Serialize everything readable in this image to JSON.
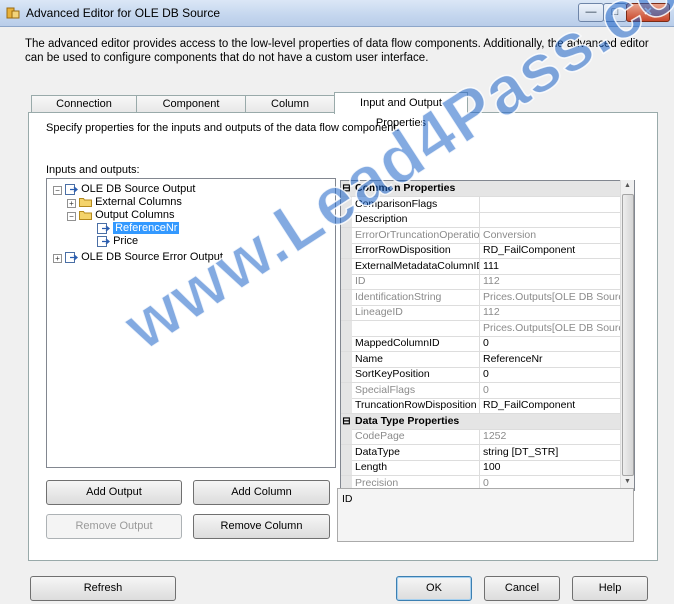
{
  "window": {
    "title": "Advanced Editor for OLE DB Source"
  },
  "description": "The advanced editor provides access to the low-level properties of data flow components. Additionally, the advanced editor can be used to configure components that do not have a custom user interface.",
  "tabs": [
    {
      "label": "Connection Managers"
    },
    {
      "label": "Component Properties"
    },
    {
      "label": "Column Mappings"
    },
    {
      "label": "Input and Output Properties"
    }
  ],
  "panel": {
    "description": "Specify properties for the inputs and outputs of the data flow component.",
    "tree_label": "Inputs and outputs:"
  },
  "tree": {
    "output": "OLE DB Source Output",
    "external": "External Columns",
    "output_columns": "Output Columns",
    "col1": "ReferenceNr",
    "col2": "Price",
    "error_output": "OLE DB Source Error Output"
  },
  "properties": [
    {
      "type": "category",
      "name": "Common Properties"
    },
    {
      "name": "ComparisonFlags",
      "value": "",
      "ro": false
    },
    {
      "name": "Description",
      "value": "",
      "ro": false
    },
    {
      "name": "ErrorOrTruncationOperation",
      "value": "Conversion",
      "ro": true
    },
    {
      "name": "ErrorRowDisposition",
      "value": "RD_FailComponent",
      "ro": false
    },
    {
      "name": "ExternalMetadataColumnID",
      "value": "111",
      "ro": false
    },
    {
      "name": "ID",
      "value": "112",
      "ro": true
    },
    {
      "name": "IdentificationString",
      "value": "Prices.Outputs[OLE DB Source",
      "ro": true
    },
    {
      "name": "LineageID",
      "value": "112",
      "ro": true
    },
    {
      "name": "",
      "value": "Prices.Outputs[OLE DB Source",
      "ro": true
    },
    {
      "name": "MappedColumnID",
      "value": "0",
      "ro": false
    },
    {
      "name": "Name",
      "value": "ReferenceNr",
      "ro": false
    },
    {
      "name": "SortKeyPosition",
      "value": "0",
      "ro": false
    },
    {
      "name": "SpecialFlags",
      "value": "0",
      "ro": true
    },
    {
      "name": "TruncationRowDisposition",
      "value": "RD_FailComponent",
      "ro": false
    },
    {
      "type": "category",
      "name": "Data Type Properties"
    },
    {
      "name": "CodePage",
      "value": "1252",
      "ro": true
    },
    {
      "name": "DataType",
      "value": "string [DT_STR]",
      "ro": false
    },
    {
      "name": "Length",
      "value": "100",
      "ro": false
    },
    {
      "name": "Precision",
      "value": "0",
      "ro": true
    }
  ],
  "help_text": "ID",
  "buttons": {
    "add_output": "Add Output",
    "add_column": "Add Column",
    "remove_output": "Remove Output",
    "remove_column": "Remove Column",
    "refresh": "Refresh",
    "ok": "OK",
    "cancel": "Cancel",
    "help": "Help"
  },
  "watermark": "www.Lead4Pass.com"
}
